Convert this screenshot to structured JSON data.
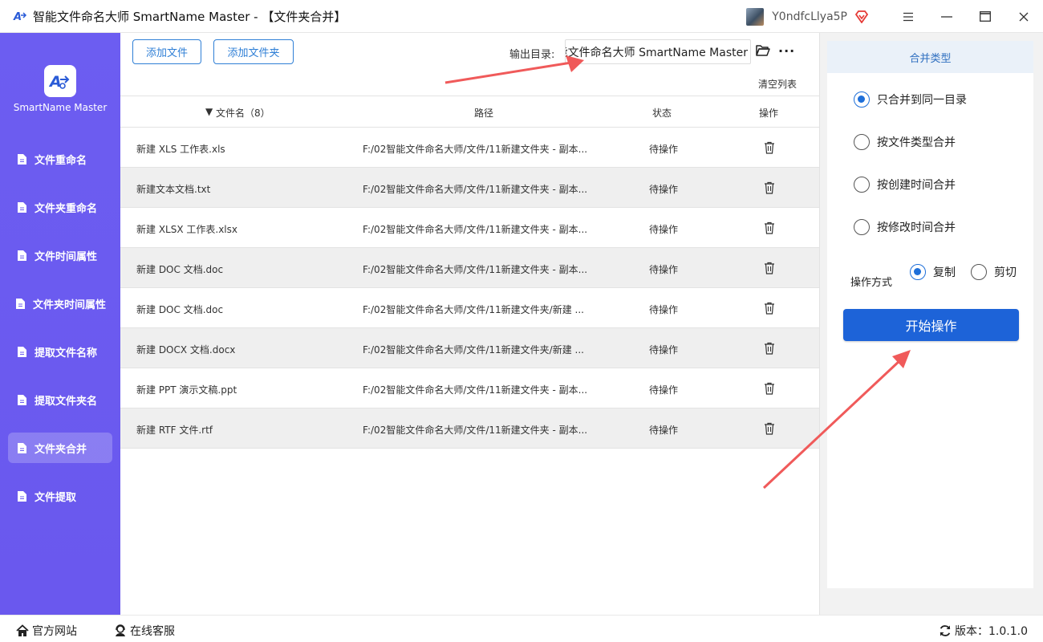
{
  "window": {
    "title": "智能文件命名大师 SmartName Master - 【文件夹合并】",
    "username": "Y0ndfcLlya5P"
  },
  "sidebar": {
    "brand": "SmartName Master",
    "items": [
      {
        "label": "文件重命名"
      },
      {
        "label": "文件夹重命名"
      },
      {
        "label": "文件时间属性"
      },
      {
        "label": "文件夹时间属性"
      },
      {
        "label": "提取文件名称"
      },
      {
        "label": "提取文件夹名"
      },
      {
        "label": "文件夹合并",
        "active": true
      },
      {
        "label": "文件提取"
      }
    ]
  },
  "toolbar": {
    "add_file": "添加文件",
    "add_folder": "添加文件夹",
    "output_label": "输出目录:",
    "output_value": "能文件命名大师 SmartName Master",
    "clear_list": "清空列表"
  },
  "table": {
    "headers": {
      "name": "文件名（8）",
      "path": "路径",
      "status": "状态",
      "action": "操作"
    },
    "rows": [
      {
        "name": "新建 XLS 工作表.xls",
        "path": "F:/02智能文件命名大师/文件/11新建文件夹 - 副本...",
        "status": "待操作"
      },
      {
        "name": "新建文本文档.txt",
        "path": "F:/02智能文件命名大师/文件/11新建文件夹 - 副本...",
        "status": "待操作"
      },
      {
        "name": "新建 XLSX 工作表.xlsx",
        "path": "F:/02智能文件命名大师/文件/11新建文件夹 - 副本...",
        "status": "待操作"
      },
      {
        "name": "新建 DOC 文档.doc",
        "path": "F:/02智能文件命名大师/文件/11新建文件夹 - 副本...",
        "status": "待操作"
      },
      {
        "name": "新建 DOC 文档.doc",
        "path": "F:/02智能文件命名大师/文件/11新建文件夹/新建 ...",
        "status": "待操作"
      },
      {
        "name": "新建 DOCX 文档.docx",
        "path": "F:/02智能文件命名大师/文件/11新建文件夹/新建 ...",
        "status": "待操作"
      },
      {
        "name": "新建 PPT 演示文稿.ppt",
        "path": "F:/02智能文件命名大师/文件/11新建文件夹 - 副本...",
        "status": "待操作"
      },
      {
        "name": "新建 RTF 文件.rtf",
        "path": "F:/02智能文件命名大师/文件/11新建文件夹 - 副本...",
        "status": "待操作"
      }
    ]
  },
  "panel": {
    "header": "合并类型",
    "merge_options": [
      {
        "label": "只合并到同一目录",
        "selected": true
      },
      {
        "label": "按文件类型合并",
        "selected": false
      },
      {
        "label": "按创建时间合并",
        "selected": false
      },
      {
        "label": "按修改时间合并",
        "selected": false
      }
    ],
    "op_mode_label": "操作方式",
    "op_copy": "复制",
    "op_cut": "剪切",
    "start": "开始操作"
  },
  "footer": {
    "website": "官方网站",
    "support": "在线客服",
    "version": "版本：1.0.1.0"
  },
  "colors": {
    "sidebar": "#6b5cf0",
    "primary": "#1d63d8",
    "arrow": "#f05a5a"
  }
}
